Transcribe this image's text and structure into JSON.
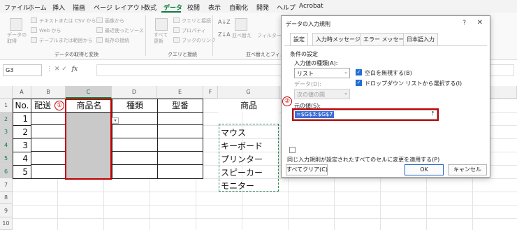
{
  "menu": {
    "items": [
      "ファイル",
      "ホーム",
      "挿入",
      "描画",
      "ページ レイアウト",
      "数式",
      "データ",
      "校閲",
      "表示",
      "自動化",
      "開発",
      "ヘルプ",
      "Acrobat"
    ],
    "active": "データ"
  },
  "ribbon": {
    "get_data": "データの\n取得",
    "from_text_csv": "テキストまたは CSV から",
    "from_web": "Web から",
    "from_table": "テーブルまたは範囲から",
    "image_from": "画像から",
    "recent_sources": "最近使ったソース",
    "existing_connections": "既存の接続",
    "group_get_transform": "データの取得と変換",
    "refresh_all": "すべて\n更新",
    "queries_connections": "クエリと接続",
    "properties": "プロパティ",
    "edit_links": "ブックのリンク",
    "group_queries": "クエリと接続",
    "sort": "並べ替え",
    "filter": "フィルター",
    "group_sort_filter": "並べ替えとフィルター"
  },
  "formula_bar": {
    "name_box": "G3",
    "icons": "⋮ ✕ ✓",
    "fx": "fx",
    "value": ""
  },
  "grid": {
    "columns": [
      "A",
      "B",
      "C",
      "D",
      "E",
      "F",
      "G"
    ],
    "rows": [
      "1",
      "2",
      "3",
      "4",
      "5",
      "6",
      "7",
      "8",
      "9",
      "10"
    ],
    "table_headers": [
      "No.",
      "配送",
      "商品名",
      "種類",
      "型番"
    ],
    "numbers": [
      "1",
      "2",
      "3",
      "4",
      "5"
    ],
    "list_header": "商品",
    "list_items": [
      "マウス",
      "キーボード",
      "プリンター",
      "スピーカー",
      "モニター"
    ]
  },
  "annotations": {
    "badge1": "①",
    "badge2": "②",
    "highlight_color": "#c00000"
  },
  "dialog": {
    "title": "データの入力規則",
    "help": "?",
    "close": "✕",
    "tabs": [
      "設定",
      "入力時メッセージ",
      "エラー メッセージ",
      "日本語入力"
    ],
    "section_label": "条件の設定",
    "allow_label": "入力値の種類(A):",
    "allow_value": "リスト",
    "ignore_blank": "空白を無視する(B)",
    "in_cell_dropdown": "ドロップダウン リストから選択する(I)",
    "data_label": "データ(D):",
    "data_value": "次の値の間",
    "source_label": "元の値(S):",
    "source_value": "=$G$3:$G$7",
    "collapse_icon": "⇡",
    "apply_all": "同じ入力規則が設定されたすべてのセルに変更を適用する(P)",
    "clear_all": "すべてクリア(C)",
    "ok": "OK",
    "cancel": "キャンセル",
    "accent": "#1f6fd0"
  }
}
